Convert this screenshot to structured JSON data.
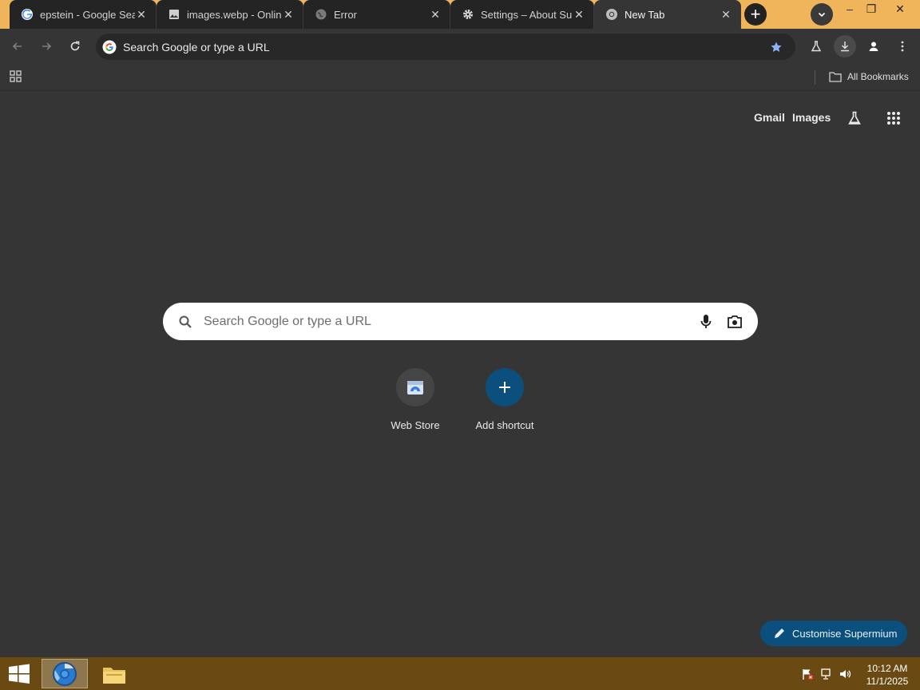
{
  "browser": {
    "tabs": [
      {
        "title": "epstein - Google Sear",
        "favicon": "google-g-icon",
        "active": false
      },
      {
        "title": "images.webp - Online",
        "favicon": "image-file-icon",
        "active": false
      },
      {
        "title": "Error",
        "favicon": "globe-icon",
        "active": false
      },
      {
        "title": "Settings – About Sup",
        "favicon": "gear-icon",
        "active": false
      },
      {
        "title": "New Tab",
        "favicon": "chromium-icon",
        "active": true
      }
    ],
    "tab_close_glyph": "✕",
    "new_tab_glyph": "+",
    "window_controls": {
      "minimize": "–",
      "restore": "❐",
      "close": "✕"
    },
    "omnibox": {
      "text": "Search Google or type a URL"
    },
    "bookmarks": {
      "all_bookmarks_label": "All Bookmarks"
    }
  },
  "ntp": {
    "links": {
      "gmail": "Gmail",
      "images": "Images"
    },
    "search": {
      "placeholder": "Search Google or type a URL"
    },
    "shortcuts": [
      {
        "label": "Web Store",
        "icon": "web-store-icon"
      },
      {
        "label": "Add shortcut",
        "icon": "plus-icon"
      }
    ],
    "customise_label": "Customise Supermium"
  },
  "taskbar": {
    "clock": {
      "time": "10:12 AM",
      "date": "11/1/2025"
    }
  },
  "colors": {
    "tabstrip_bg": "#f0b45a",
    "toolbar_bg": "#353535",
    "page_bg": "#353535",
    "customise_bg": "#0b4f7c",
    "add_shortcut_bg": "#0b4f7c",
    "taskbar_bg": "#6a4a12"
  }
}
